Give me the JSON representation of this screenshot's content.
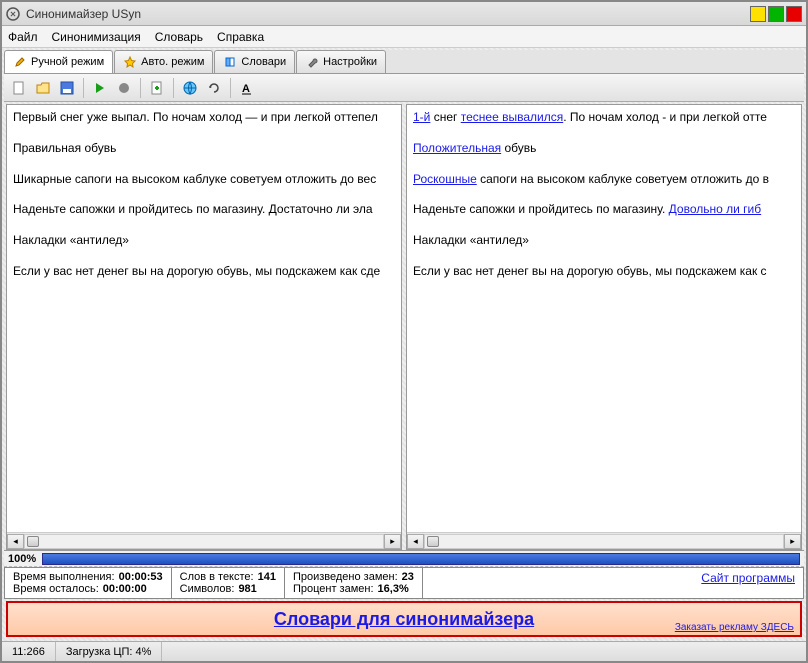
{
  "title": "Синонимайзер USyn",
  "menus": [
    "Файл",
    "Синонимизация",
    "Словарь",
    "Справка"
  ],
  "tabs": [
    {
      "label": "Ручной режим",
      "icon": "pencil-icon"
    },
    {
      "label": "Авто. режим",
      "icon": "star-icon"
    },
    {
      "label": "Словари",
      "icon": "book-icon"
    },
    {
      "label": "Настройки",
      "icon": "wrench-icon"
    }
  ],
  "left_paras": [
    "Первый снег уже выпал. По ночам холод — и при легкой оттепел",
    "Правильная обувь",
    "Шикарные сапоги на высоком каблуке советуем отложить до вес",
    "Наденьте сапожки и пройдитесь по магазину. Достаточно ли эла",
    "Накладки «антилед»",
    "Если у вас нет денег вы на дорогую обувь, мы подскажем как сде"
  ],
  "right_paras": [
    [
      {
        "t": "1-й",
        "s": true
      },
      {
        "t": " снег "
      },
      {
        "t": "теснее вывалился",
        "s": true
      },
      {
        "t": ". По ночам холод - и при легкой отте"
      }
    ],
    [
      {
        "t": "Положительная",
        "s": true
      },
      {
        "t": " обувь"
      }
    ],
    [
      {
        "t": "Роскошные",
        "s": true
      },
      {
        "t": " сапоги на высоком каблуке советуем отложить до в"
      }
    ],
    [
      {
        "t": "Наденьте сапожки и пройдитесь по магазину. "
      },
      {
        "t": "Довольно ли гиб",
        "s": true
      }
    ],
    [
      {
        "t": "Накладки «антилед»"
      }
    ],
    [
      {
        "t": "Если у вас нет денег вы на дорогую обувь, мы подскажем как с"
      }
    ]
  ],
  "progress_label": "100%",
  "stats": {
    "time_exec_l": "Время выполнения:",
    "time_exec_v": "00:00:53",
    "time_left_l": "Время осталось:",
    "time_left_v": "00:00:00",
    "words_l": "Слов в тексте:",
    "words_v": "141",
    "chars_l": "Символов:",
    "chars_v": "981",
    "repl_l": "Произведено замен:",
    "repl_v": "23",
    "pct_l": "Процент замен:",
    "pct_v": "16,3%",
    "site_link": "Сайт программы"
  },
  "ad_main": "Словари для синонимайзера",
  "ad_order": "Заказать рекламу ЗДЕСЬ",
  "status": {
    "pos": "11:266",
    "cpu_l": "Загрузка ЦП:",
    "cpu_v": "4%"
  }
}
